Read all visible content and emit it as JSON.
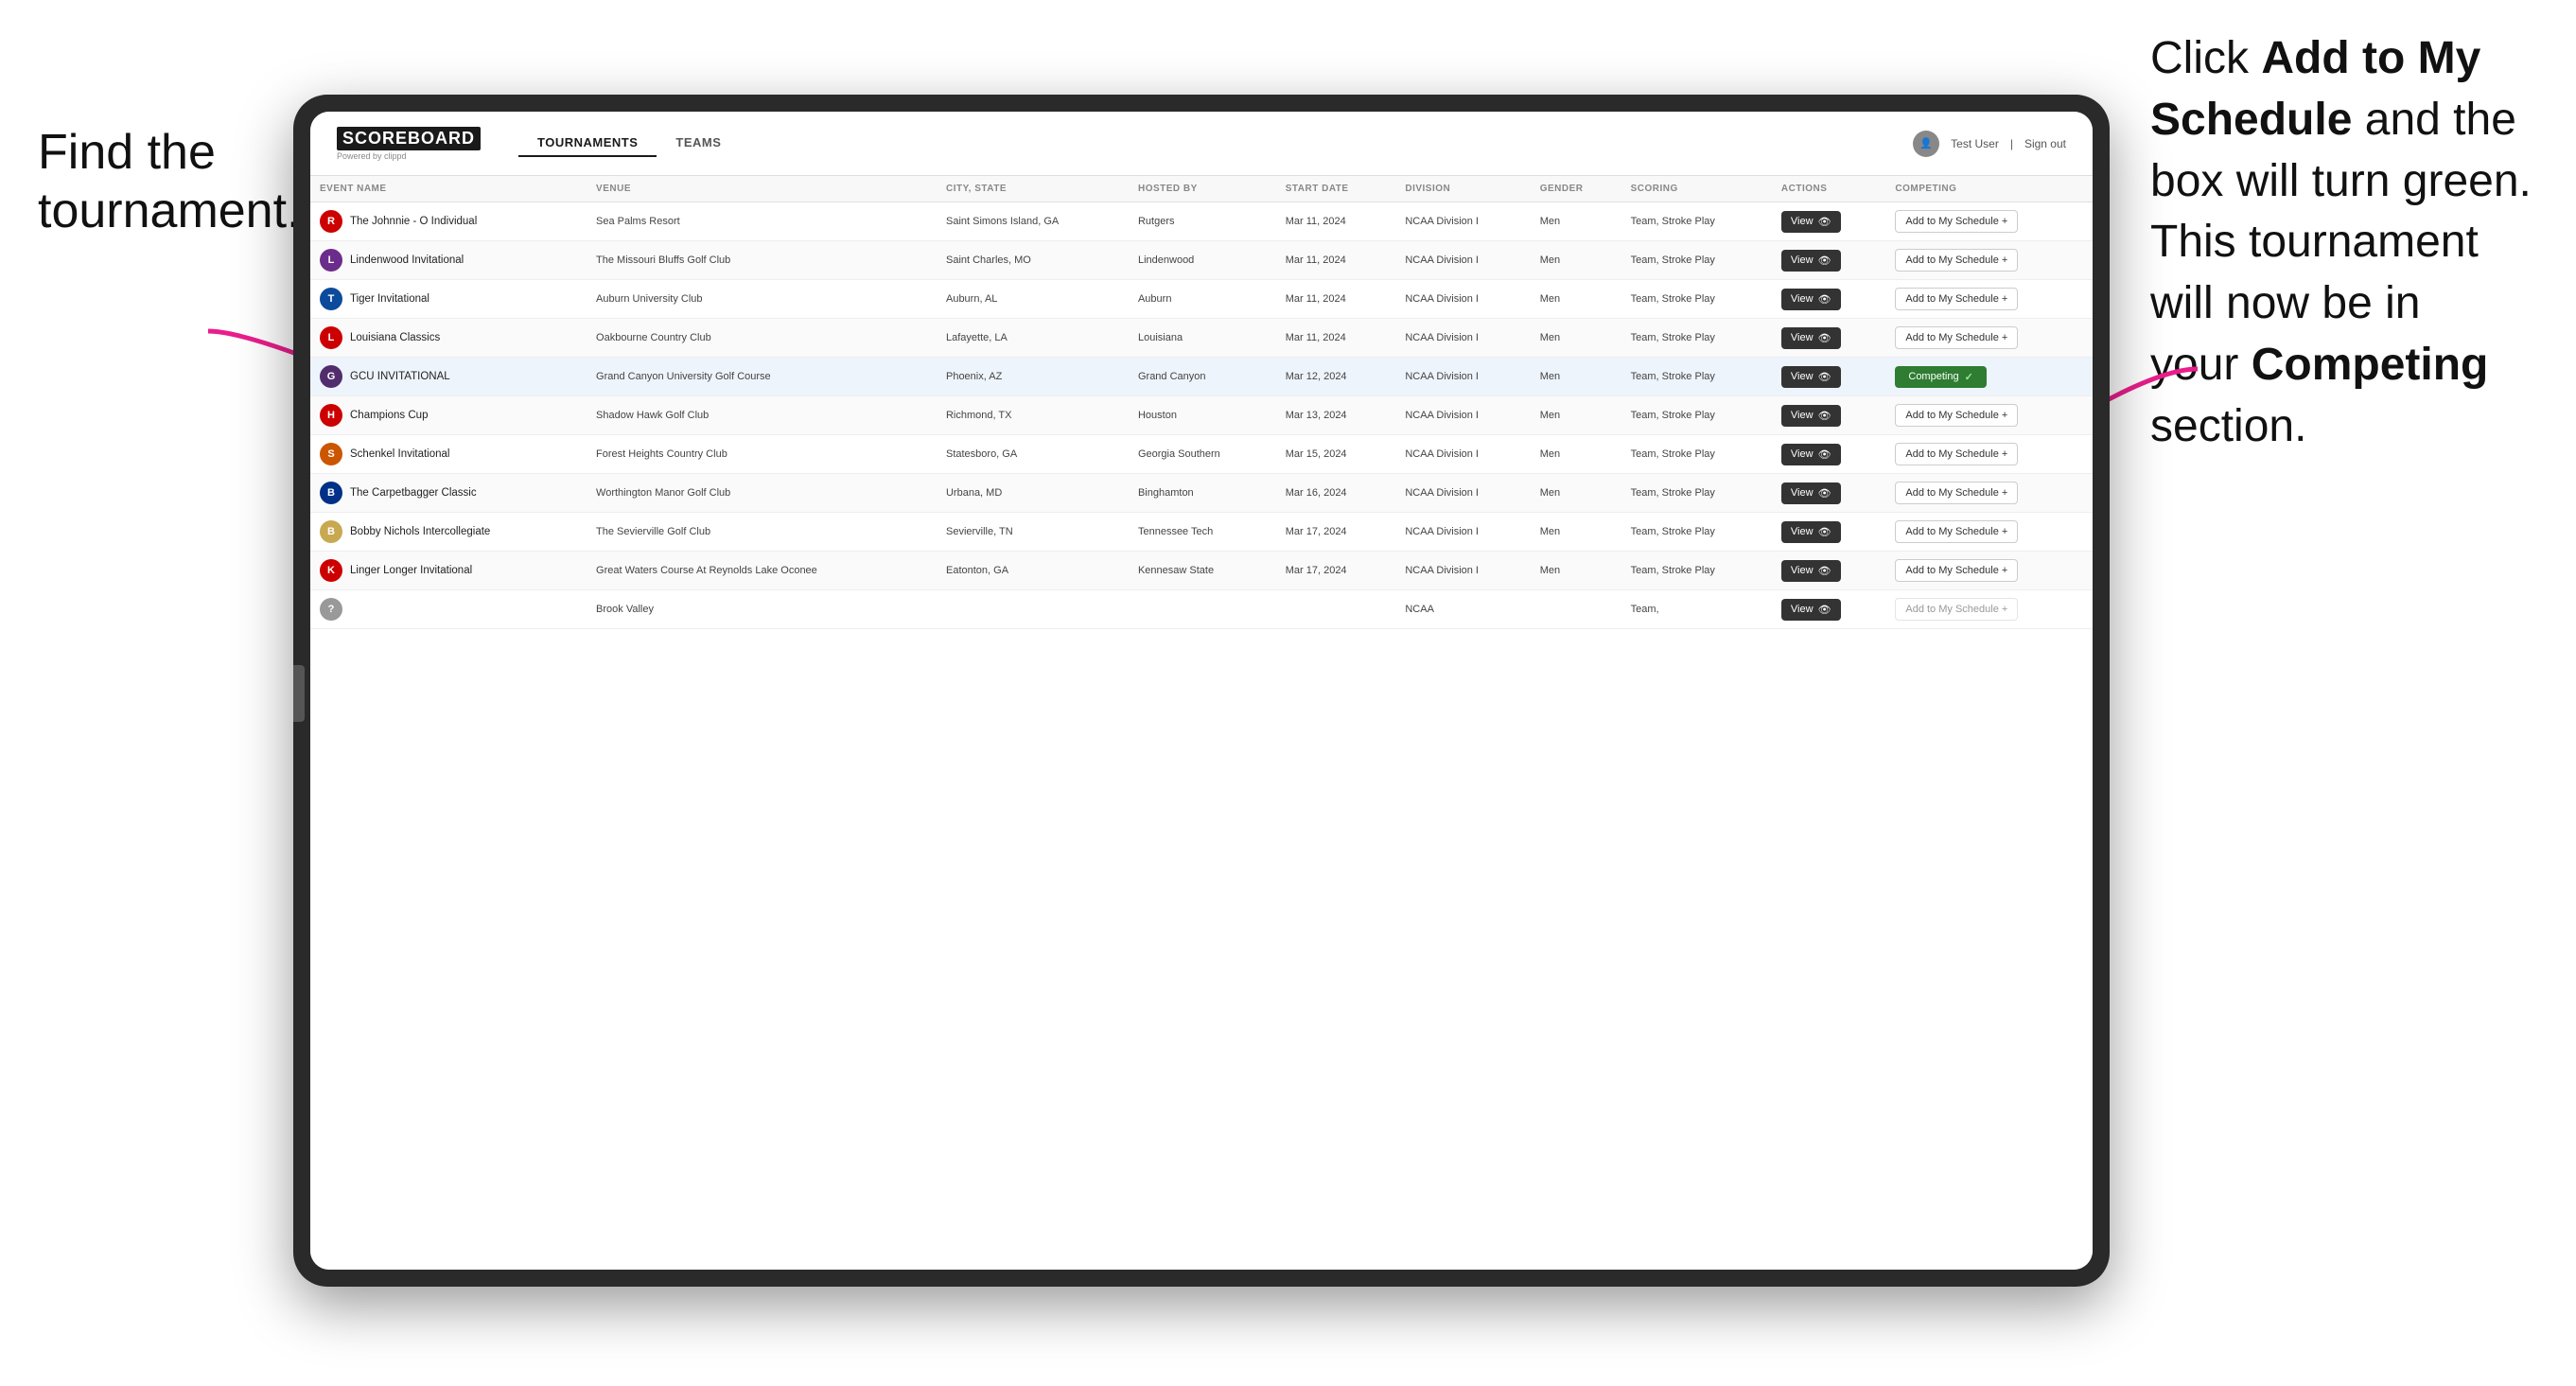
{
  "annotations": {
    "left": "Find the\ntournament.",
    "right_line1": "Click ",
    "right_bold1": "Add to My\nSchedule",
    "right_line2": " and the\nbox will turn green.\nThis tournament\nwill now be in\nyour ",
    "right_bold2": "Competing",
    "right_line3": " section."
  },
  "header": {
    "logo": "SCOREBOARD",
    "logo_sub": "Powered by clippd",
    "nav": [
      "TOURNAMENTS",
      "TEAMS"
    ],
    "active_tab": "TOURNAMENTS",
    "user": "Test User",
    "sign_out": "Sign out"
  },
  "table": {
    "columns": [
      "EVENT NAME",
      "VENUE",
      "CITY, STATE",
      "HOSTED BY",
      "START DATE",
      "DIVISION",
      "GENDER",
      "SCORING",
      "ACTIONS",
      "COMPETING"
    ],
    "rows": [
      {
        "logo_color": "#cc0000",
        "logo_letter": "R",
        "event": "The Johnnie - O Individual",
        "venue": "Sea Palms Resort",
        "city": "Saint Simons Island, GA",
        "host": "Rutgers",
        "date": "Mar 11, 2024",
        "division": "NCAA Division I",
        "gender": "Men",
        "scoring": "Team, Stroke Play",
        "competing": false,
        "highlighted": false
      },
      {
        "logo_color": "#6b2d8b",
        "logo_letter": "L",
        "event": "Lindenwood Invitational",
        "venue": "The Missouri Bluffs Golf Club",
        "city": "Saint Charles, MO",
        "host": "Lindenwood",
        "date": "Mar 11, 2024",
        "division": "NCAA Division I",
        "gender": "Men",
        "scoring": "Team, Stroke Play",
        "competing": false,
        "highlighted": false
      },
      {
        "logo_color": "#0055a4",
        "logo_letter": "T",
        "event": "Tiger Invitational",
        "venue": "Auburn University Club",
        "city": "Auburn, AL",
        "host": "Auburn",
        "date": "Mar 11, 2024",
        "division": "NCAA Division I",
        "gender": "Men",
        "scoring": "Team, Stroke Play",
        "competing": false,
        "highlighted": false
      },
      {
        "logo_color": "#cc0000",
        "logo_letter": "L",
        "event": "Louisiana Classics",
        "venue": "Oakbourne Country Club",
        "city": "Lafayette, LA",
        "host": "Louisiana",
        "date": "Mar 11, 2024",
        "division": "NCAA Division I",
        "gender": "Men",
        "scoring": "Team, Stroke Play",
        "competing": false,
        "highlighted": false
      },
      {
        "logo_color": "#512d6d",
        "logo_letter": "G",
        "event": "GCU INVITATIONAL",
        "venue": "Grand Canyon University Golf Course",
        "city": "Phoenix, AZ",
        "host": "Grand Canyon",
        "date": "Mar 12, 2024",
        "division": "NCAA Division I",
        "gender": "Men",
        "scoring": "Team, Stroke Play",
        "competing": true,
        "highlighted": true
      },
      {
        "logo_color": "#cc0000",
        "logo_letter": "H",
        "event": "Champions Cup",
        "venue": "Shadow Hawk Golf Club",
        "city": "Richmond, TX",
        "host": "Houston",
        "date": "Mar 13, 2024",
        "division": "NCAA Division I",
        "gender": "Men",
        "scoring": "Team, Stroke Play",
        "competing": false,
        "highlighted": false
      },
      {
        "logo_color": "#cc5500",
        "logo_letter": "S",
        "event": "Schenkel Invitational",
        "venue": "Forest Heights Country Club",
        "city": "Statesboro, GA",
        "host": "Georgia Southern",
        "date": "Mar 15, 2024",
        "division": "NCAA Division I",
        "gender": "Men",
        "scoring": "Team, Stroke Play",
        "competing": false,
        "highlighted": false
      },
      {
        "logo_color": "#003087",
        "logo_letter": "B",
        "event": "The Carpetbagger Classic",
        "venue": "Worthington Manor Golf Club",
        "city": "Urbana, MD",
        "host": "Binghamton",
        "date": "Mar 16, 2024",
        "division": "NCAA Division I",
        "gender": "Men",
        "scoring": "Team, Stroke Play",
        "competing": false,
        "highlighted": false
      },
      {
        "logo_color": "#c8a951",
        "logo_letter": "B",
        "event": "Bobby Nichols Intercollegiate",
        "venue": "The Sevierville Golf Club",
        "city": "Sevierville, TN",
        "host": "Tennessee Tech",
        "date": "Mar 17, 2024",
        "division": "NCAA Division I",
        "gender": "Men",
        "scoring": "Team, Stroke Play",
        "competing": false,
        "highlighted": false
      },
      {
        "logo_color": "#cc0000",
        "logo_letter": "K",
        "event": "Linger Longer Invitational",
        "venue": "Great Waters Course At Reynolds Lake Oconee",
        "city": "Eatonton, GA",
        "host": "Kennesaw State",
        "date": "Mar 17, 2024",
        "division": "NCAA Division I",
        "gender": "Men",
        "scoring": "Team, Stroke Play",
        "competing": false,
        "highlighted": false
      },
      {
        "logo_color": "#555",
        "logo_letter": "?",
        "event": "",
        "venue": "Brook Valley",
        "city": "",
        "host": "",
        "date": "",
        "division": "NCAA",
        "gender": "",
        "scoring": "Team,",
        "competing": false,
        "highlighted": false,
        "partial": true
      }
    ],
    "view_label": "View",
    "add_schedule_label": "Add to My Schedule +",
    "competing_label": "Competing",
    "competing_check": "✓"
  }
}
